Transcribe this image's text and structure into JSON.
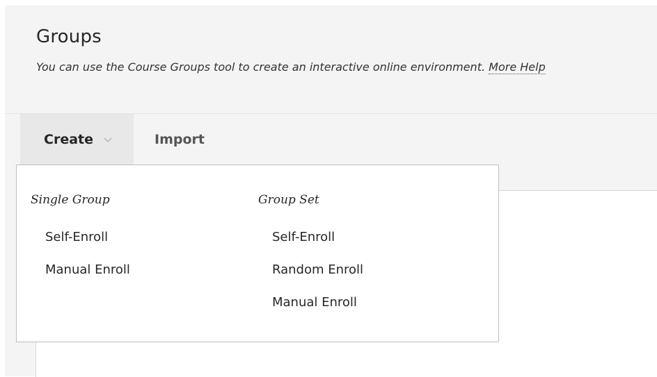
{
  "header": {
    "title": "Groups",
    "description": "You can use the Course Groups tool to create an interactive online environment.",
    "help_link": "More Help"
  },
  "toolbar": {
    "create_label": "Create",
    "import_label": "Import"
  },
  "dropdown": {
    "single_group": {
      "heading": "Single Group",
      "items": [
        "Self-Enroll",
        "Manual Enroll"
      ]
    },
    "group_set": {
      "heading": "Group Set",
      "items": [
        "Self-Enroll",
        "Random Enroll",
        "Manual Enroll"
      ]
    }
  }
}
